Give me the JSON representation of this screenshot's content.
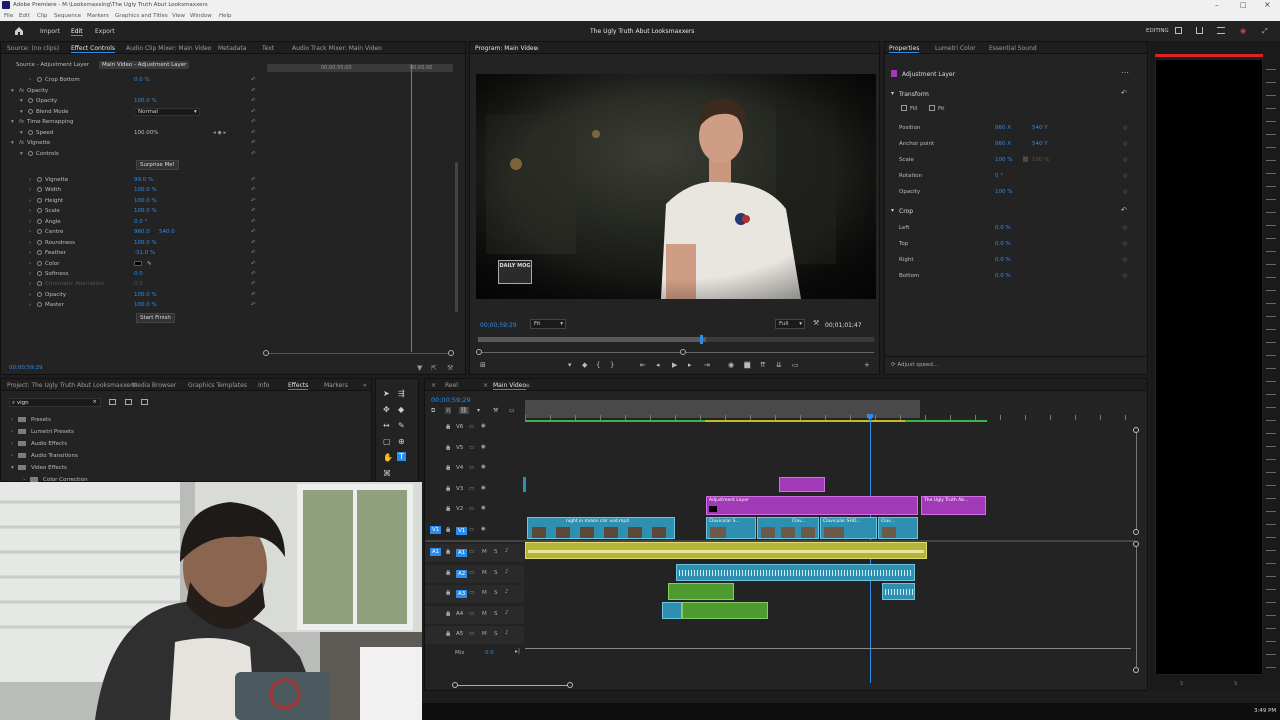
{
  "app": {
    "title": "Adobe Premiere - M:\\Looksmaxxing\\The Ugly Truth Abut Looksmaxxers",
    "menu": [
      "File",
      "Edit",
      "Clip",
      "Sequence",
      "Markers",
      "Graphics and Titles",
      "View",
      "Window",
      "Help"
    ],
    "workspace_tabs": [
      "Import",
      "Edit",
      "Export"
    ],
    "project_title": "The Ugly Truth Abut Looksmaxxers",
    "workspace_label": "EDITING",
    "clock": "3:49 PM"
  },
  "effect_controls": {
    "tabs": [
      "Source: (no clips)",
      "Effect Controls",
      "Audio Clip Mixer: Main Video",
      "Metadata",
      "Text",
      "Audio Track Mixer: Main Video"
    ],
    "subtabs": [
      "Source - Adjustment Layer",
      "Main Video - Adjustment Layer"
    ],
    "timecode_a": "00;00;55;00",
    "timecode_b": "00;00;00",
    "rows": [
      {
        "label": "Crop Bottom",
        "value": "0.0 %",
        "indent": 2
      },
      {
        "label": "Opacity",
        "value": "",
        "indent": 0,
        "fx": true
      },
      {
        "label": "Opacity",
        "value": "100.0 %",
        "indent": 1
      },
      {
        "label": "Blend Mode",
        "value": "Normal",
        "indent": 1,
        "dropdown": true
      },
      {
        "label": "Time Remapping",
        "value": "",
        "indent": 0,
        "fx": true
      },
      {
        "label": "Speed",
        "value": "100.00%",
        "indent": 1
      },
      {
        "label": "Vignette",
        "value": "",
        "indent": 0,
        "fx": true
      },
      {
        "label": "Controls",
        "value": "",
        "indent": 1
      },
      {
        "label": "Surprise Me!",
        "value": "",
        "indent": 0,
        "button": true
      },
      {
        "label": "Vignette",
        "value": "99.0 %",
        "indent": 2
      },
      {
        "label": "Width",
        "value": "100.0 %",
        "indent": 2
      },
      {
        "label": "Height",
        "value": "100.0 %",
        "indent": 2
      },
      {
        "label": "Scale",
        "value": "100.0 %",
        "indent": 2
      },
      {
        "label": "Angle",
        "value": "0.0 °",
        "indent": 2
      },
      {
        "label": "Centre",
        "value": "960.0",
        "value2": "540.0",
        "indent": 2
      },
      {
        "label": "Roundness",
        "value": "100.0 %",
        "indent": 2
      },
      {
        "label": "Feather",
        "value": "-31.0 %",
        "indent": 2
      },
      {
        "label": "Color",
        "value": "",
        "indent": 2,
        "swatch": true
      },
      {
        "label": "Softness",
        "value": "0.0",
        "indent": 2
      },
      {
        "label": "Chromatic Aberration",
        "value": "0.0",
        "indent": 2,
        "disabled": true
      },
      {
        "label": "Opacity",
        "value": "100.0 %",
        "indent": 2
      },
      {
        "label": "Master",
        "value": "100.0 %",
        "indent": 2
      },
      {
        "label": "Start Finish",
        "value": "",
        "indent": 0,
        "button": true
      }
    ],
    "footer_timecode": "00;00;59;29"
  },
  "program_monitor": {
    "tab": "Program: Main Video",
    "timecode": "00;00;59;29",
    "fit": "Fit",
    "quality": "Full",
    "duration": "00;01;01;47",
    "watermark": "DAILY MOG"
  },
  "properties": {
    "tabs": [
      "Properties",
      "Lumetri Color",
      "Essential Sound"
    ],
    "layer": "Adjustment Layer",
    "transform_title": "Transform",
    "fill": "Fill",
    "fit": "Fit",
    "rows": [
      {
        "label": "Position",
        "v1": "960 X",
        "v2": "540 Y"
      },
      {
        "label": "Anchor point",
        "v1": "960 X",
        "v2": "540 Y"
      },
      {
        "label": "Scale",
        "v1": "100 %",
        "v2": "100 %"
      },
      {
        "label": "Rotation",
        "v1": "0 °",
        "v2": ""
      },
      {
        "label": "Opacity",
        "v1": "100 %",
        "v2": ""
      }
    ],
    "crop_title": "Crop",
    "crop_rows": [
      {
        "label": "Left",
        "v1": "0.0 %"
      },
      {
        "label": "Top",
        "v1": "0.0 %"
      },
      {
        "label": "Right",
        "v1": "0.0 %"
      },
      {
        "label": "Bottom",
        "v1": "0.0 %"
      }
    ],
    "adjust_speed": "Adjust speed..."
  },
  "project": {
    "tabs": [
      "Project: The Ugly Truth Abut Looksmaxxers",
      "Media Browser",
      "Graphics Templates",
      "Info",
      "Effects",
      "Markers"
    ],
    "search_value": "vign",
    "tree": [
      "Presets",
      "Lumetri Presets",
      "Audio Effects",
      "Audio Transitions",
      "Video Effects",
      "Color Correction"
    ]
  },
  "timeline": {
    "tabs": [
      "Reel",
      "Main Video"
    ],
    "timecode": "00;00;59;29",
    "tracks": [
      "V6",
      "V5",
      "V4",
      "V3",
      "V2",
      "V1",
      "A1",
      "A2",
      "A3",
      "A4",
      "A5"
    ],
    "mix_label": "Mix",
    "mix_value": "0.0",
    "clips": {
      "v1_a": "night in miami clsr vod.mp4",
      "v1_b": "Clavicular S...",
      "v1_c": "Clav...",
      "v1_d": "Clavicular SHO...",
      "v1_e": "Clav...",
      "v2_a": "Adjustment Layer",
      "v2_b": "The Ugly Truth Ab..."
    }
  },
  "colors": {
    "accent": "#2d8ceb",
    "clip_video": "#2f8fb0",
    "clip_adjust": "#a23ab7",
    "clip_audio_yellow": "#b5b33a",
    "clip_audio_blue": "#2f8fb0",
    "clip_audio_green": "#4d9a2e"
  }
}
